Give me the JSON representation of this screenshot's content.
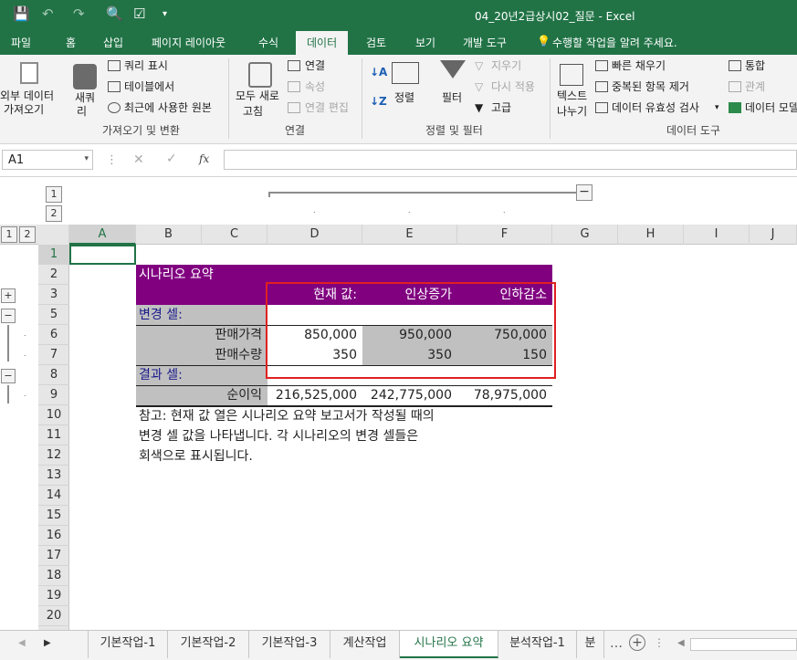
{
  "window": {
    "title": "04_20년2급상시02_질문 - Excel"
  },
  "ribbon_tabs": [
    "파일",
    "홈",
    "삽입",
    "페이지 레이아웃",
    "수식",
    "데이터",
    "검토",
    "보기",
    "개발 도구"
  ],
  "active_tab": "데이터",
  "tell_me": "수행할 작업을 알려 주세요.",
  "ribbon": {
    "get_external": [
      "외부 데이터",
      "가져오기"
    ],
    "new_query": [
      "새쿼",
      "리"
    ],
    "show_query": "쿼리 표시",
    "from_table": "테이블에서",
    "recent_sources": "최근에 사용한 원본",
    "group_get": "가져오기 및 변환",
    "refresh_all": [
      "모두 새로",
      "고침"
    ],
    "connections": "연결",
    "properties": "속성",
    "edit_links": "연결 편집",
    "group_conn": "연결",
    "sort": "정렬",
    "filter": "필터",
    "clear": "지우기",
    "reapply": "다시 적용",
    "advanced": "고급",
    "group_sort": "정렬 및 필터",
    "text_to_cols": [
      "텍스트",
      "나누기"
    ],
    "flash_fill": "빠른 채우기",
    "remove_dup": "중복된 항목 제거",
    "validation": "데이터 유효성 검사",
    "consolidate": "통합",
    "relationships": "관계",
    "data_model": "데이터 모델",
    "group_tools": "데이터 도구"
  },
  "namebox": "A1",
  "fx": "fx",
  "outline_levels": [
    "1",
    "2"
  ],
  "columns": [
    "A",
    "B",
    "C",
    "D",
    "E",
    "F",
    "G",
    "H",
    "I",
    "J"
  ],
  "rows": [
    "1",
    "2",
    "3",
    "5",
    "6",
    "7",
    "8",
    "9",
    "10",
    "11",
    "12",
    "13",
    "14",
    "15",
    "16",
    "17",
    "18",
    "19",
    "20"
  ],
  "report": {
    "title": "시나리오 요약",
    "hdr_current": "현재 값:",
    "hdr_s1": "인상증가",
    "hdr_s2": "인하감소",
    "changing": "변경 셀:",
    "price_label": "판매가격",
    "price": [
      "850,000",
      "950,000",
      "750,000"
    ],
    "qty_label": "판매수량",
    "qty": [
      "350",
      "350",
      "150"
    ],
    "result": "결과 셀:",
    "profit_label": "순이익",
    "profit": [
      "216,525,000",
      "242,775,000",
      "78,975,000"
    ],
    "note1": "참고: 현재 값 열은 시나리오 요약 보고서가 작성될 때의",
    "note2": "변경 셀 값을 나타냅니다. 각 시나리오의 변경 셀들은",
    "note3": "회색으로 표시됩니다."
  },
  "sheets": [
    "기본작업-1",
    "기본작업-2",
    "기본작업-3",
    "계산작업",
    "시나리오 요약",
    "분석작업-1",
    "분"
  ],
  "active_sheet": "시나리오 요약",
  "colors": {
    "accent": "#217346",
    "report_header": "#800080",
    "changing_gray": "#c0c0c0",
    "highlight_box": "#e02020"
  }
}
